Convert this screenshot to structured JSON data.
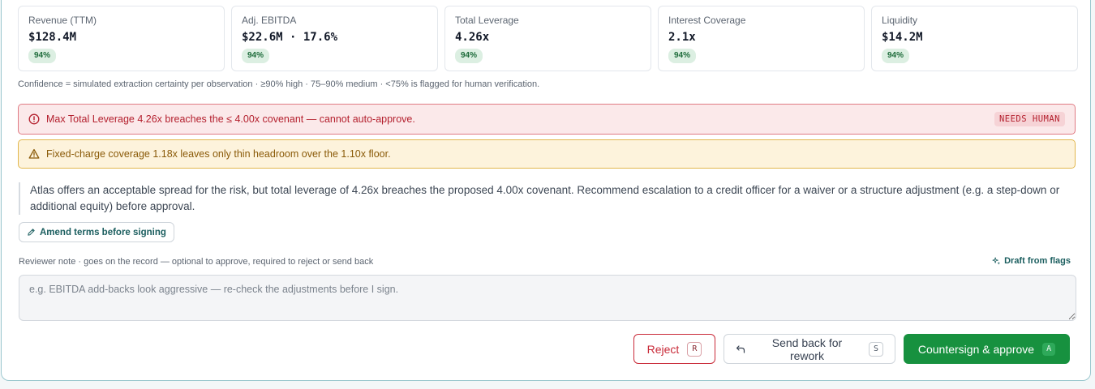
{
  "metrics": [
    {
      "label": "Revenue (TTM)",
      "value": "$128.4M",
      "confidence": "94%"
    },
    {
      "label": "Adj. EBITDA",
      "value": "$22.6M · 17.6%",
      "confidence": "94%"
    },
    {
      "label": "Total Leverage",
      "value": "4.26x",
      "confidence": "94%"
    },
    {
      "label": "Interest Coverage",
      "value": "2.1x",
      "confidence": "94%"
    },
    {
      "label": "Liquidity",
      "value": "$14.2M",
      "confidence": "94%"
    }
  ],
  "confidence_note": "Confidence = simulated extraction certainty per observation · ≥90% high · 75–90% medium · <75% is flagged for human verification.",
  "alerts": {
    "danger": {
      "text": "Max Total Leverage 4.26x breaches the ≤ 4.00x covenant — cannot auto-approve.",
      "badge": "NEEDS HUMAN",
      "icon": "alert-circle-icon"
    },
    "warning": {
      "text": "Fixed-charge coverage 1.18x leaves only thin headroom over the 1.10x floor.",
      "icon": "warning-triangle-icon"
    }
  },
  "recommendation": "Atlas offers an acceptable spread for the risk, but total leverage of 4.26x breaches the proposed 4.00x covenant. Recommend escalation to a credit officer for a waiver or a structure adjustment (e.g. a step-down or additional equity) before approval.",
  "amend_button": {
    "label": "Amend terms before signing",
    "icon": "pencil-icon"
  },
  "reviewer_note": {
    "label": "Reviewer note · goes on the record — optional to approve, required to reject or send back",
    "draft_label": "Draft from flags",
    "draft_icon": "sparkle-icon",
    "placeholder": "e.g. EBITDA add-backs look aggressive — re-check the adjustments before I sign.",
    "value": ""
  },
  "actions": {
    "reject": {
      "label": "Reject",
      "shortcut": "R"
    },
    "send_back": {
      "label": "Send back for rework",
      "shortcut": "S",
      "icon": "undo-arrow-icon"
    },
    "approve": {
      "label": "Countersign & approve",
      "shortcut": "A"
    }
  },
  "colors": {
    "accent": "#1b5e5f",
    "danger": "#c92b39",
    "warning": "#8a5a08",
    "success": "#17913f",
    "confidence_badge": "#dcefe2"
  }
}
